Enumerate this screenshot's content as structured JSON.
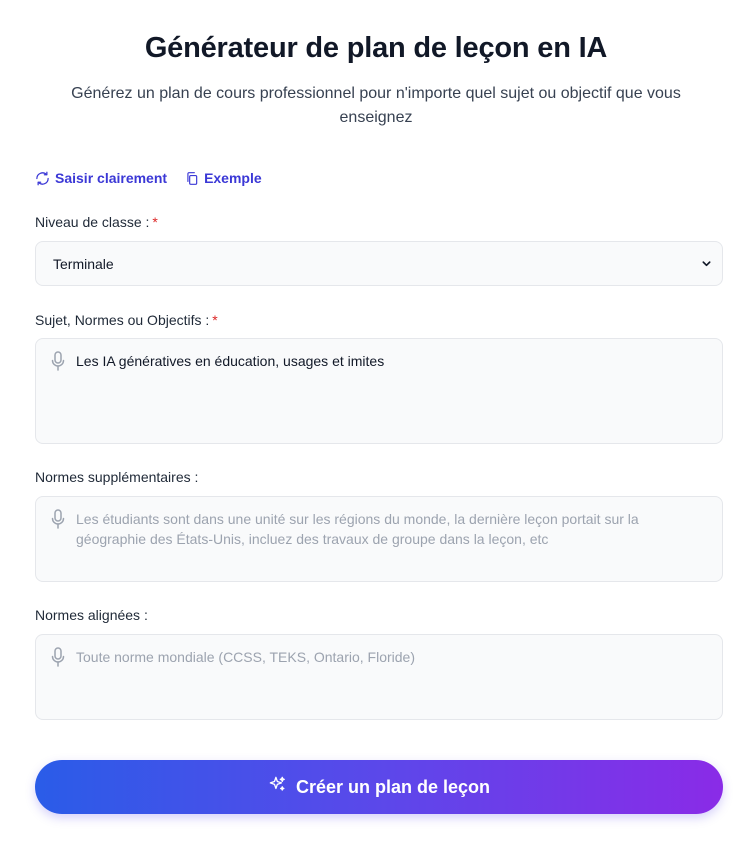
{
  "header": {
    "title": "Générateur de plan de leçon en IA",
    "subtitle": "Générez un plan de cours professionnel pour n'importe quel sujet ou objectif que vous enseignez"
  },
  "actions": {
    "clear_label": "Saisir clairement",
    "example_label": "Exemple",
    "accent_color": "#3b38d6"
  },
  "form": {
    "grade": {
      "label": "Niveau de classe :",
      "required_mark": "*",
      "selected": "Terminale"
    },
    "subject": {
      "label": "Sujet, Normes ou Objectifs :",
      "required_mark": "*",
      "value": "Les IA génératives en éducation, usages et imites"
    },
    "additional": {
      "label": "Normes supplémentaires :",
      "placeholder": "Les étudiants sont dans une unité sur les régions du monde, la dernière leçon portait sur la géographie des États-Unis, incluez des travaux de groupe dans la leçon, etc"
    },
    "aligned": {
      "label": "Normes alignées :",
      "placeholder": "Toute norme mondiale (CCSS, TEKS, Ontario, Floride)"
    }
  },
  "submit": {
    "label": "Créer un plan de leçon",
    "gradient_start": "#2a5ce8",
    "gradient_end": "#8a2be7"
  },
  "icons": {
    "clear": "refresh-icon",
    "example": "copy-icon",
    "mic": "microphone-icon",
    "select": "chevron-down-icon",
    "submit": "sparkles-icon"
  }
}
